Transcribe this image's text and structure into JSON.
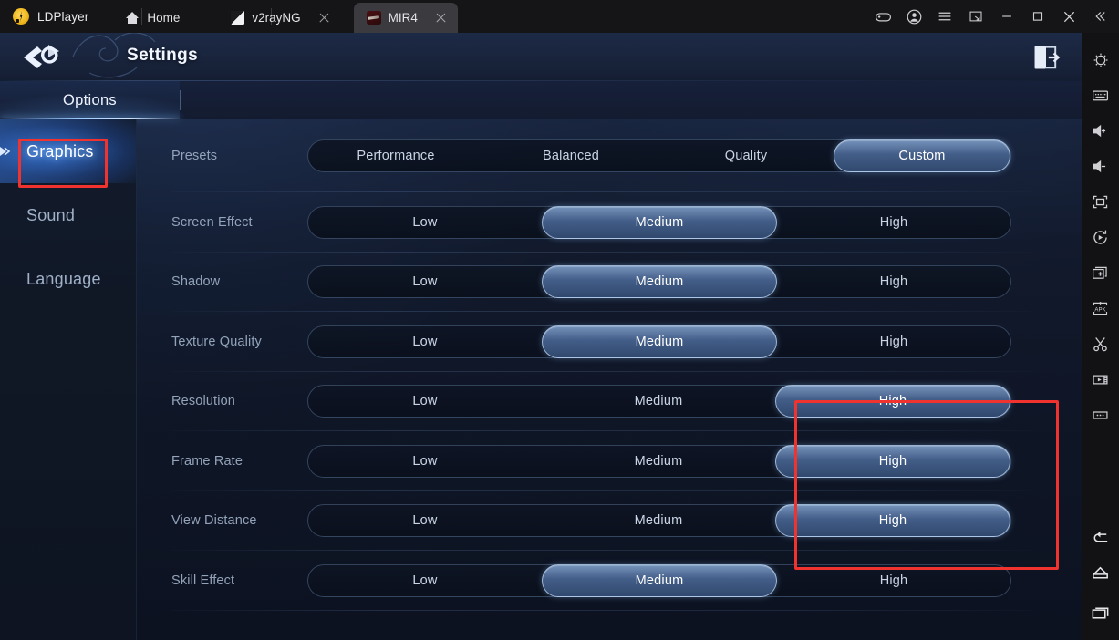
{
  "titlebar": {
    "brand": "LDPlayer",
    "brand_icon": "ldplayer-logo-icon",
    "tabs": [
      {
        "label": "Home",
        "icon": "home-icon",
        "active": false,
        "closable": false
      },
      {
        "label": "v2rayNG",
        "icon": "v2rayng-icon",
        "active": false,
        "closable": true
      },
      {
        "label": "MIR4",
        "icon": "mir4-icon",
        "active": true,
        "closable": true
      }
    ],
    "window_buttons": [
      "gamepad-icon",
      "account-icon",
      "menu-icon",
      "resize-icon",
      "minimize-icon",
      "maximize-icon",
      "close-icon",
      "collapse-icon"
    ]
  },
  "rail": {
    "top_icons": [
      "settings-gear-icon",
      "keyboard-icon",
      "volume-up-icon",
      "volume-down-icon",
      "fullscreen-icon",
      "rotate-icon",
      "new-window-icon",
      "install-apk-icon",
      "scissors-icon",
      "record-video-icon",
      "more-icon"
    ],
    "bottom_icons": [
      "back-icon",
      "home-icon",
      "recents-icon"
    ]
  },
  "game": {
    "header": {
      "title": "Settings",
      "brand_icon": "mir4-brand-icon",
      "exit_icon": "exit-door-icon"
    },
    "tabs": [
      {
        "label": "Options",
        "active": true
      }
    ],
    "nav": [
      {
        "label": "Graphics",
        "active": true
      },
      {
        "label": "Sound",
        "active": false
      },
      {
        "label": "Language",
        "active": false
      }
    ],
    "settings": [
      {
        "label": "Presets",
        "options": [
          "Performance",
          "Balanced",
          "Quality",
          "Custom"
        ],
        "selected": "Custom"
      },
      {
        "label": "Screen Effect",
        "options": [
          "Low",
          "Medium",
          "High"
        ],
        "selected": "Medium"
      },
      {
        "label": "Shadow",
        "options": [
          "Low",
          "Medium",
          "High"
        ],
        "selected": "Medium"
      },
      {
        "label": "Texture Quality",
        "options": [
          "Low",
          "Medium",
          "High"
        ],
        "selected": "Medium"
      },
      {
        "label": "Resolution",
        "options": [
          "Low",
          "Medium",
          "High"
        ],
        "selected": "High"
      },
      {
        "label": "Frame Rate",
        "options": [
          "Low",
          "Medium",
          "High"
        ],
        "selected": "High"
      },
      {
        "label": "View Distance",
        "options": [
          "Low",
          "Medium",
          "High"
        ],
        "selected": "High"
      },
      {
        "label": "Skill Effect",
        "options": [
          "Low",
          "Medium",
          "High"
        ],
        "selected": "Medium"
      }
    ]
  },
  "annotations": {
    "color": "#f1332f",
    "boxes": [
      "graphics-nav-highlight",
      "high-options-highlight"
    ]
  }
}
